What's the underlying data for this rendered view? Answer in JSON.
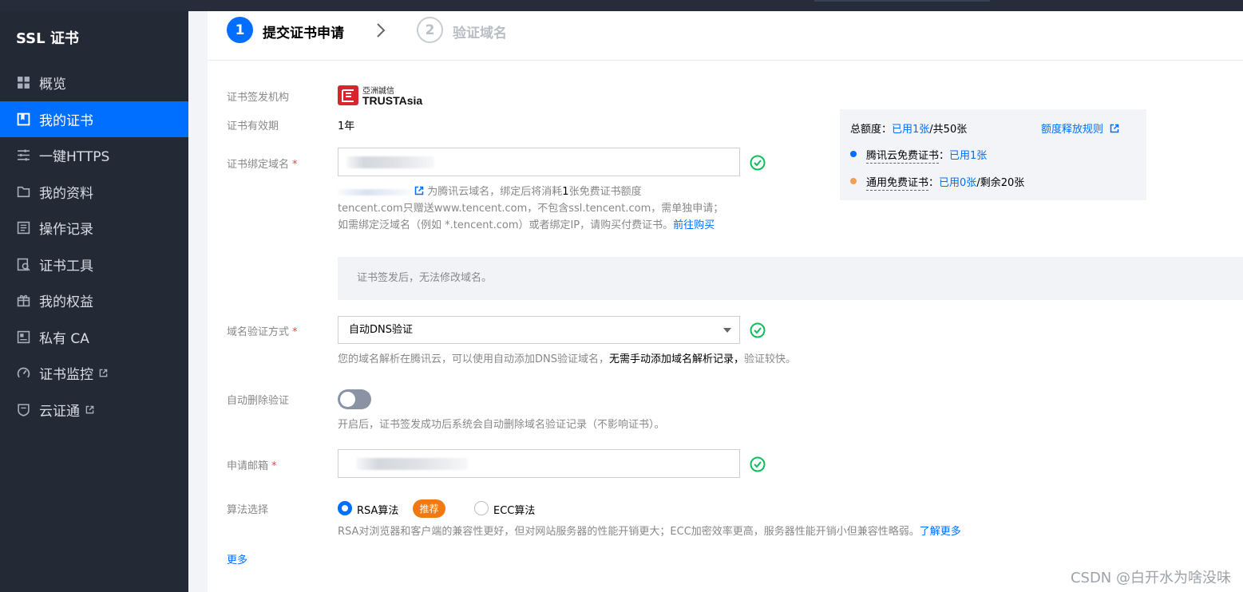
{
  "sidebar": {
    "title": "SSL 证书",
    "items": [
      {
        "label": "概览",
        "icon": "grid-icon",
        "active": false,
        "external": false
      },
      {
        "label": "我的证书",
        "icon": "bookmark-icon",
        "active": true,
        "external": false
      },
      {
        "label": "一键HTTPS",
        "icon": "sliders-icon",
        "active": false,
        "external": false
      },
      {
        "label": "我的资料",
        "icon": "folder-icon",
        "active": false,
        "external": false
      },
      {
        "label": "操作记录",
        "icon": "log-icon",
        "active": false,
        "external": false
      },
      {
        "label": "证书工具",
        "icon": "tool-icon",
        "active": false,
        "external": false
      },
      {
        "label": "我的权益",
        "icon": "gift-icon",
        "active": false,
        "external": false
      },
      {
        "label": "私有 CA",
        "icon": "ca-icon",
        "active": false,
        "external": false
      },
      {
        "label": "证书监控",
        "icon": "monitor-icon",
        "active": false,
        "external": true
      },
      {
        "label": "云证通",
        "icon": "cloud-cert-icon",
        "active": false,
        "external": true
      }
    ]
  },
  "steps": [
    {
      "number": "1",
      "label": "提交证书申请",
      "active": true
    },
    {
      "number": "2",
      "label": "验证域名",
      "active": false
    }
  ],
  "form": {
    "issuer_label": "证书签发机构",
    "issuer_logo_text": "TRUSTAsia",
    "issuer_logo_cjk": "亞洲誠信",
    "validity_label": "证书有效期",
    "validity_value": "1年",
    "domain_label": "证书绑定域名",
    "domain_required": "*",
    "domain_hint_1": "为腾讯云域名，绑定后将消耗",
    "domain_hint_count": "1",
    "domain_hint_1b": "张免费证书额度",
    "domain_hint_2": "tencent.com只赠送www.tencent.com，不包含ssl.tencent.com，需单独申请；",
    "domain_hint_3": "如需绑定泛域名（例如 *.tencent.com）或者绑定IP，请购买付费证书。",
    "domain_hint_link": "前往购买",
    "notice": "证书签发后，无法修改域名。",
    "verify_label": "域名验证方式",
    "verify_required": "*",
    "verify_value": "自动DNS验证",
    "verify_hint_a": "您的域名解析在腾讯云，可以使用自动添加DNS验证域名，",
    "verify_hint_b": "无需手动添加域名解析记录，",
    "verify_hint_c": "验证较快。",
    "autodel_label": "自动删除验证",
    "autodel_on": false,
    "autodel_hint": "开启后，证书签发成功后系统会自动删除域名验证记录（不影响证书）。",
    "email_label": "申请邮箱",
    "email_required": "*",
    "algo_label": "算法选择",
    "algo_options": [
      {
        "label": "RSA算法",
        "selected": true
      },
      {
        "label": "ECC算法",
        "selected": false
      }
    ],
    "algo_badge": "推荐",
    "algo_hint": "RSA对浏览器和客户端的兼容性更好，但对网站服务器的性能开销更大；ECC加密效率更高，服务器性能开销小但兼容性略弱。",
    "algo_hint_link": "了解更多",
    "more_link": "更多"
  },
  "quota": {
    "total_label": "总额度：",
    "total_used": "已用1张",
    "total_rest": "/共50张",
    "rules_link": "额度释放规则",
    "rows": [
      {
        "label": "腾讯云免费证书",
        "colon": "：",
        "used": "已用1张",
        "rest": "",
        "color": "#006eff"
      },
      {
        "label": "通用免费证书",
        "colon": "：",
        "used": "已用0张",
        "rest": "/剩余20张",
        "color": "#f0a050"
      }
    ]
  },
  "watermark": "CSDN @白开水为啥没味",
  "colors": {
    "accent": "#006eff",
    "sidebar_bg": "#232a36",
    "success": "#0abf5b",
    "badge": "#f07a11"
  }
}
